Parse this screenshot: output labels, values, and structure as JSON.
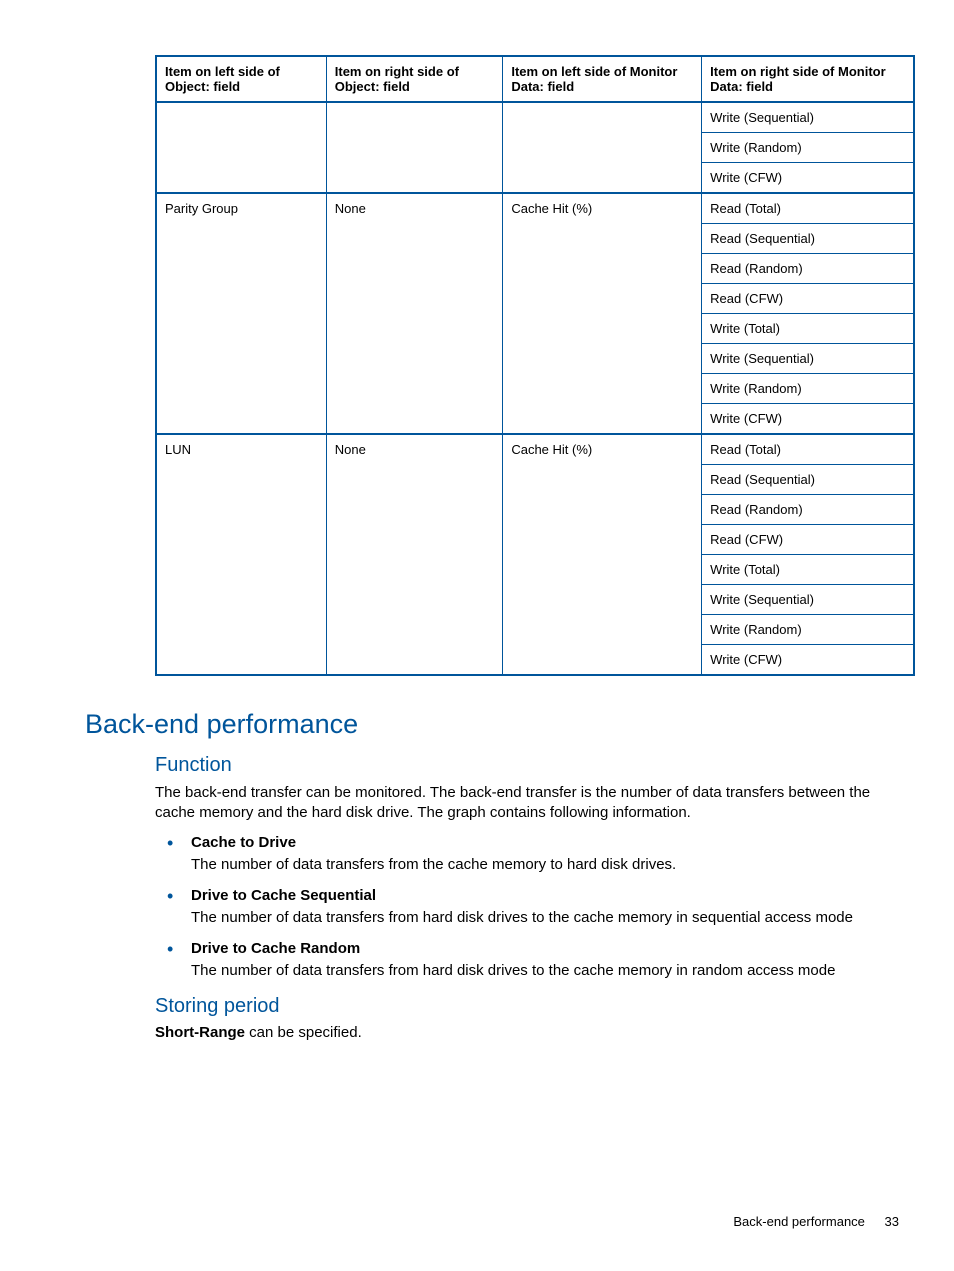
{
  "table": {
    "headers": [
      "Item on left side of Object: field",
      "Item on right side of Object: field",
      "Item on left side of Monitor Data: field",
      "Item on right side of Monitor Data: field"
    ],
    "group0_rows": [
      "Write (Sequential)",
      "Write (Random)",
      "Write (CFW)"
    ],
    "group1": {
      "c0": "Parity Group",
      "c1": "None",
      "c2": "Cache Hit (%)",
      "rows": [
        "Read (Total)",
        "Read (Sequential)",
        "Read (Random)",
        "Read (CFW)",
        "Write (Total)",
        "Write (Sequential)",
        "Write (Random)",
        "Write (CFW)"
      ]
    },
    "group2": {
      "c0": "LUN",
      "c1": "None",
      "c2": "Cache Hit (%)",
      "rows": [
        "Read (Total)",
        "Read (Sequential)",
        "Read (Random)",
        "Read (CFW)",
        "Write (Total)",
        "Write (Sequential)",
        "Write (Random)",
        "Write (CFW)"
      ]
    }
  },
  "section": {
    "title": "Back-end performance",
    "function": {
      "heading": "Function",
      "intro": "The back-end transfer can be monitored. The back-end transfer is the number of data transfers between the cache memory and the hard disk drive. The graph contains following information.",
      "items": [
        {
          "title": "Cache to Drive",
          "desc": "The number of data transfers from the cache memory to hard disk drives."
        },
        {
          "title": "Drive to Cache Sequential",
          "desc": "The number of data transfers from hard disk drives to the cache memory in sequential access mode"
        },
        {
          "title": "Drive to Cache Random",
          "desc": "The number of data transfers from hard disk drives to the cache memory in random access mode"
        }
      ]
    },
    "storing": {
      "heading": "Storing period",
      "bold": "Short-Range",
      "rest": " can be specified."
    }
  },
  "footer": {
    "label": "Back-end performance",
    "page": "33"
  }
}
